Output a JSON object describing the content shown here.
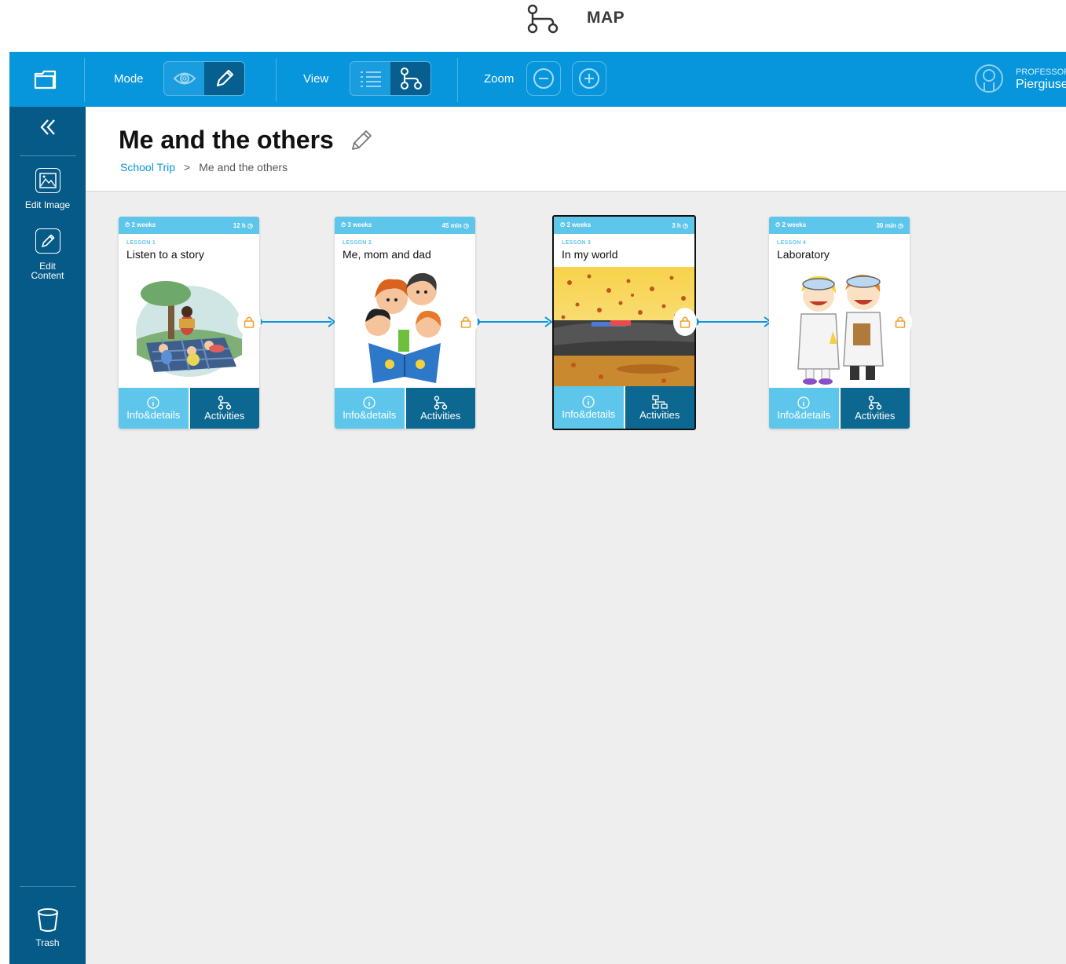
{
  "caption": {
    "text": "MAP",
    "icon": "map-icon"
  },
  "topbar": {
    "mode_label": "Mode",
    "view_label": "View",
    "zoom_label": "Zoom",
    "user_role": "PROFESSOR",
    "user_name": "Piergiuse"
  },
  "sidebar": {
    "edit_image_label": "Edit Image",
    "edit_content_line1": "Edit",
    "edit_content_line2": "Content",
    "trash_label": "Trash"
  },
  "header": {
    "title": "Me and the others",
    "breadcrumb": {
      "parent": "School Trip",
      "separator": ">",
      "current": "Me and the others"
    }
  },
  "lessons": [
    {
      "duration": "2 weeks",
      "time": "12 h",
      "lesson": "LESSON 1",
      "title": "Listen to a story",
      "info_label": "Info&details",
      "activities_label": "Activities",
      "image": "picnic-reading-illustration"
    },
    {
      "duration": "3 weeks",
      "time": "45 min",
      "lesson": "LESSON 2",
      "title": "Me, mom and dad",
      "info_label": "Info&details",
      "activities_label": "Activities",
      "image": "family-book-illustration"
    },
    {
      "duration": "2 weeks",
      "time": "3 h",
      "lesson": "LESSON 3",
      "title": "In my world",
      "info_label": "Info&details",
      "activities_label": "Activities",
      "image": "autumn-leaves-photo"
    },
    {
      "duration": "2 weeks",
      "time": "30 min",
      "lesson": "LESSON 4",
      "title": "Laboratory",
      "info_label": "Info&details",
      "activities_label": "Activities",
      "image": "kids-scientists-illustration"
    }
  ],
  "colors": {
    "topbar": "#0795dc",
    "sidebar": "#065a87",
    "card_top": "#5dc6ea",
    "activities": "#0c6791",
    "lock": "#f0a030"
  }
}
